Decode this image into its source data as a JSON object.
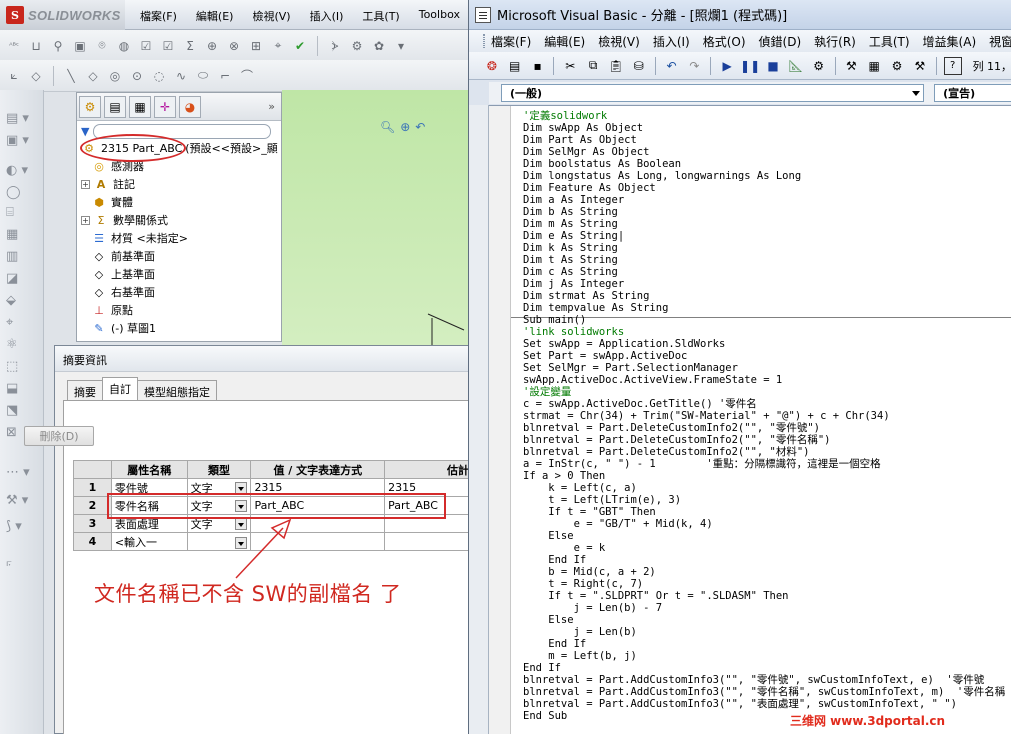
{
  "sw": {
    "app_name": "SOLIDWORKS",
    "logo_mark": "S",
    "menu": [
      "檔案(F)",
      "編輯(E)",
      "檢視(V)",
      "插入(I)",
      "工具(T)",
      "Toolbox"
    ],
    "tree": {
      "part_name": "2315 Part_ABC",
      "part_config": "(預設<<預設>_顯",
      "items": [
        "感測器",
        "註記",
        "實體",
        "數學關係式",
        "材質 <未指定>",
        "前基準面",
        "上基準面",
        "右基準面",
        "原點",
        "(-) 草圖1"
      ]
    },
    "dialog": {
      "title": "摘要資訊",
      "tabs": [
        "摘要",
        "自訂",
        "模型組態指定"
      ],
      "delete_button": "刪除(D)",
      "table": {
        "headers": [
          "屬性名稱",
          "類型",
          "值 / 文字表達方式",
          "估計"
        ],
        "rows": [
          {
            "num": "1",
            "name": "零件號",
            "type": "文字",
            "value": "2315",
            "evaluated": "2315"
          },
          {
            "num": "2",
            "name": "零件名稱",
            "type": "文字",
            "value": "Part_ABC",
            "evaluated": "Part_ABC"
          },
          {
            "num": "3",
            "name": "表面處理",
            "type": "文字",
            "value": "",
            "evaluated": ""
          },
          {
            "num": "4",
            "name": "<輸入一",
            "type": "",
            "value": "",
            "evaluated": ""
          }
        ]
      }
    },
    "annotation": "文件名稱已不含  SW的副檔名 了"
  },
  "vb": {
    "title": "Microsoft Visual Basic - 分離 - [照爛1 (程式碼)]",
    "menu": [
      "檔案(F)",
      "編輯(E)",
      "檢視(V)",
      "插入(I)",
      "格式(O)",
      "偵錯(D)",
      "執行(R)",
      "工具(T)",
      "增益集(A)",
      "視窗(W)"
    ],
    "cursor_pos": "列 11，",
    "object_combo": "(一般)",
    "proc_combo": "(宣告)",
    "code": [
      "'定義solidwork",
      "Dim swApp As Object",
      "Dim Part As Object",
      "Dim SelMgr As Object",
      "Dim boolstatus As Boolean",
      "Dim longstatus As Long, longwarnings As Long",
      "Dim Feature As Object",
      "Dim a As Integer",
      "Dim b As String",
      "Dim m As String",
      "Dim e As String|",
      "Dim k As String",
      "Dim t As String",
      "Dim c As String",
      "Dim j As Integer",
      "Dim strmat As String",
      "Dim tempvalue As String",
      "Sub main()",
      "'link solidworks",
      "Set swApp = Application.SldWorks",
      "Set Part = swApp.ActiveDoc",
      "Set SelMgr = Part.SelectionManager",
      "swApp.ActiveDoc.ActiveView.FrameState = 1",
      "'設定變量",
      "c = swApp.ActiveDoc.GetTitle() '零件名",
      "strmat = Chr(34) + Trim(\"SW-Material\" + \"@\") + c + Chr(34)",
      "blnretval = Part.DeleteCustomInfo2(\"\", \"零件號\")",
      "blnretval = Part.DeleteCustomInfo2(\"\", \"零件名稱\")",
      "blnretval = Part.DeleteCustomInfo2(\"\", \"材料\")",
      "a = InStr(c, \" \") - 1        '重點：分隔標識符，這裡是一個空格",
      "If a > 0 Then",
      "    k = Left(c, a)",
      "    t = Left(LTrim(e), 3)",
      "    If t = \"GBT\" Then",
      "        e = \"GB/T\" + Mid(k, 4)",
      "    Else",
      "        e = k",
      "    End If",
      "    b = Mid(c, a + 2)",
      "    t = Right(c, 7)",
      "    If t = \".SLDPRT\" Or t = \".SLDASM\" Then",
      "        j = Len(b) - 7",
      "    Else",
      "        j = Len(b)",
      "    End If",
      "    m = Left(b, j)",
      "End If",
      "blnretval = Part.AddCustomInfo3(\"\", \"零件號\", swCustomInfoText, e)  '零件號",
      "blnretval = Part.AddCustomInfo3(\"\", \"零件名稱\", swCustomInfoText, m)  '零件名稱",
      "blnretval = Part.AddCustomInfo3(\"\", \"表面處理\", swCustomInfoText, \" \")",
      "End Sub"
    ],
    "comment_lines": [
      0,
      18,
      23
    ]
  },
  "watermark": "三维网 www.3dportal.cn",
  "colors": {
    "highlight": "#d42b2b",
    "comment": "#007a00",
    "graphics": "#c6e9b0"
  }
}
